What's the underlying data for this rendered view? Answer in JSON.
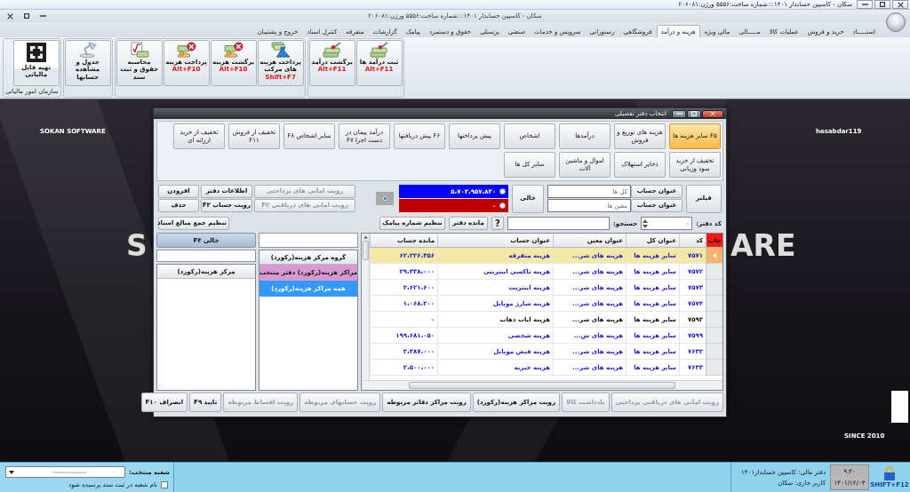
{
  "title_strip": {
    "title": "سکان - کاسپین حسابدار ۱۴۰۱:::شماره ساخت:۵۵۵۶ ورژن:۲۰۶۰۸۱"
  },
  "window": {
    "title": "سکان - کاسپین حسابدار ۱۴۰۱:::شماره ساخت:۵۵۵۶ ورژن:۲۰۶۰۸۱"
  },
  "menu": [
    {
      "label": "استـــــاد",
      "selected": false
    },
    {
      "label": "خرید و فروش",
      "selected": false
    },
    {
      "label": "عملیات کالا",
      "selected": false
    },
    {
      "label": "مـــــالی",
      "selected": false
    },
    {
      "label": "مالی ویژه",
      "selected": false
    },
    {
      "label": "هزینه و درآمد",
      "selected": true
    },
    {
      "label": "فروشگاهی",
      "selected": false
    },
    {
      "label": "رستورانی",
      "selected": false
    },
    {
      "label": "سرویس و خدمات",
      "selected": false
    },
    {
      "label": "صنعتی",
      "selected": false
    },
    {
      "label": "پرسنلی",
      "selected": false
    },
    {
      "label": "حقوق و دستمزد",
      "selected": false
    },
    {
      "label": "پیامک",
      "selected": false
    },
    {
      "label": "گزارشات",
      "selected": false
    },
    {
      "label": "متفرقه",
      "selected": false
    },
    {
      "label": "کنترل اسناد",
      "selected": false
    },
    {
      "label": "خروج و پشتیبان",
      "selected": false
    }
  ],
  "ribbon": {
    "groups": [
      {
        "buttons": [
          {
            "label": "ثبت درآمد ها",
            "shortcut": "Alt+F11",
            "kind": "income"
          },
          {
            "label": "برگشت درآمد",
            "shortcut": "Alt+F11",
            "kind": "income"
          }
        ]
      },
      {
        "buttons": [
          {
            "label": "پرداخت هزینه های مرکب",
            "shortcut": "Shift+F7",
            "kind": "compound"
          },
          {
            "label": "برگشت هزینه",
            "shortcut": "Alt+F10",
            "kind": "refund"
          },
          {
            "label": "پرداخت هزینه",
            "shortcut": "Alt+F10",
            "kind": "refund"
          },
          {
            "label": "محاسبه حقوق و ثبت سند",
            "kind": "payroll"
          }
        ]
      },
      {
        "buttons": [
          {
            "label": "جدول و مشاهده حسابها",
            "kind": "ledger"
          }
        ]
      },
      {
        "caption": "سازمان امور مالیاتی",
        "buttons": [
          {
            "label": "تهیه فایل مالیاتی",
            "kind": "tax"
          }
        ]
      }
    ]
  },
  "wallpaper": {
    "brand": "SOKAN SOFTWARE",
    "site": "hesabdar119",
    "logo_left": "S",
    "logo_right": "ARE",
    "since": "SINCE 2010"
  },
  "dialog": {
    "title": "انتخاب دفتر تفصیلی",
    "categories": [
      {
        "label": "F۵ سایر هزینه ها",
        "selected": true
      },
      {
        "label": "هزینه های توزیع و فروش",
        "selected": false
      },
      {
        "label": "درآمدها",
        "selected": false
      },
      {
        "label": "اشخاص",
        "selected": false
      },
      {
        "label": "پیش پرداختها",
        "selected": false
      },
      {
        "label": "F۶ پیش دریافتها",
        "selected": false
      },
      {
        "label": "درآمد پیمان در دست اجرا F۷",
        "selected": false
      },
      {
        "label": "سایر اشخاص F۸",
        "selected": false
      },
      {
        "label": "تخفیف از فروش F۱۱",
        "selected": false
      },
      {
        "label": "تخفیف از خرید ارزانه ای",
        "selected": false
      },
      {
        "label": "تخفیف از خرید سود وزیانی",
        "selected": false
      },
      {
        "label": "ذخایر استهلاک",
        "selected": false
      },
      {
        "label": "اموال و ماشین آلات",
        "selected": false
      },
      {
        "label": "سایر کل ها",
        "selected": false
      }
    ],
    "filter_button": "فیلتر",
    "account_filters": [
      {
        "button": "عنوان حساب",
        "placeholder": "کل ها"
      },
      {
        "button": "عنوان حساب",
        "placeholder": "معین ها"
      }
    ],
    "clear_button": "خالی",
    "balances": [
      {
        "value": "۵،۷۰۳،۹۵۷،۸۳۰",
        "color": "#0000ff",
        "selected": false
      },
      {
        "value": "۰",
        "color": "#c00000",
        "selected": false
      }
    ],
    "neutral_option": {
      "selected": true
    },
    "actions": [
      {
        "label": "رویت امانی های پرداختی",
        "disabled": true
      },
      {
        "label": "اطلاعات دفتر",
        "disabled": false
      },
      {
        "label": "افزودن",
        "disabled": false
      },
      {
        "label": "رویت امانی های دریافتی F۲",
        "disabled": true
      },
      {
        "label": "رویت حساب F۳",
        "disabled": false
      },
      {
        "label": "حذف",
        "disabled": false
      }
    ],
    "search": {
      "code_label": "کد دفتر:",
      "code_value": "-",
      "search_label": "جستجو:",
      "help": "?",
      "balance_button": "مانده دفتر",
      "sms_button": "تنظیم شماره پیامک",
      "totals_button": "تنظیم جمع مبالغ اسناد"
    },
    "table": {
      "selector_header": "چاپ",
      "columns": [
        "کد",
        "عنوان کل",
        "عنوان معین",
        "عنوان حساب",
        "مانده حساب"
      ],
      "rows": [
        {
          "selected": true,
          "nonzero": true,
          "cells": [
            "۷۵۷۱",
            "سایر هزینه ها",
            "هزینه های شر...",
            "هزینه متفرقه",
            "۶۲،۲۲۶،۳۵۶"
          ]
        },
        {
          "selected": false,
          "nonzero": true,
          "cells": [
            "۷۵۷۲",
            "سایر هزینه ها",
            "هزینه های شر...",
            "هزینه تاکسی اینترنتی",
            "۲۹،۳۳۸،۰۰۰"
          ]
        },
        {
          "selected": false,
          "nonzero": true,
          "cells": [
            "۷۵۷۳",
            "سایر هزینه ها",
            "هزینه های شر...",
            "هزینه اینترنت",
            "۲،۶۲۱،۶۰۰"
          ]
        },
        {
          "selected": false,
          "nonzero": true,
          "cells": [
            "۷۵۷۴",
            "سایر هزینه ها",
            "هزینه های شر...",
            "هزینه شارژ موبایل",
            "۱،۰۶۸،۲۰۰"
          ]
        },
        {
          "selected": false,
          "nonzero": false,
          "cells": [
            "۷۵۹۲",
            "سایر هزینه ها",
            "هزینه های شر...",
            "هزینه ایاب ذهاب",
            "۰"
          ]
        },
        {
          "selected": false,
          "nonzero": true,
          "cells": [
            "۷۵۹۹",
            "سایر هزینه ها",
            "هزینه های ش...",
            "هزینه شخصی",
            "۱۹۹،۶۸۱،۰۵۰"
          ]
        },
        {
          "selected": false,
          "nonzero": true,
          "cells": [
            "۷۶۳۲",
            "سایر هزینه ها",
            "هزینه های شر...",
            "هزینه قبض موبایل",
            "۲،۳۸۷،۰۰۰"
          ]
        },
        {
          "selected": false,
          "nonzero": true,
          "cells": [
            "۷۶۳۳",
            "سایر هزینه ها",
            "هزینه های شر...",
            "هزینه خیریه",
            "۲،۵۰۰،۰۰۰"
          ]
        }
      ]
    },
    "middle_panel": {
      "header": "گروه مرکز هزینه(رکورد)",
      "items": [
        {
          "label": "مراکز هزینه(رکورد) دفتر منتخب",
          "selected": false,
          "color": "#d99ad3"
        },
        {
          "label": "همه مراکز هزینه(رکورد)",
          "selected": true,
          "color": "#3399ff"
        }
      ]
    },
    "left_panel": {
      "button": "خالی F۴",
      "header": "مرکز هزینه(رکورد)"
    },
    "bottom_buttons": [
      {
        "label": "رویت امانی های دریافتی پرداختی",
        "disabled": true
      },
      {
        "label": "یادداشت کالا",
        "disabled": true
      },
      {
        "label": "رویت مراکز هزینه(رکورد)",
        "disabled": false
      },
      {
        "label": "رویت مراکز دفاتر مربوطه",
        "disabled": false
      },
      {
        "label": "رویت حسابهای مربوطه",
        "disabled": true
      },
      {
        "label": "رویت اقساط مربوطه",
        "disabled": true
      },
      {
        "label": "تایید F۹",
        "disabled": false
      },
      {
        "label": "انصراف F۱۰",
        "disabled": false
      }
    ]
  },
  "status_bar": {
    "lock": "SHIFT+F12",
    "time": "۹:۴۰",
    "date": "۱۴۰۱/۱۲/۰۳",
    "ledger": "دفتر مالی: کاسپین حسابدار۱۴۰۱",
    "user": "کاربر جاری: سکان",
    "branch_label": "شعبه منتخب:",
    "branch_value": "---------------",
    "ask_branch": {
      "label": "نام شعبه در ثبت سند پرسیده شود",
      "checked": false
    }
  }
}
